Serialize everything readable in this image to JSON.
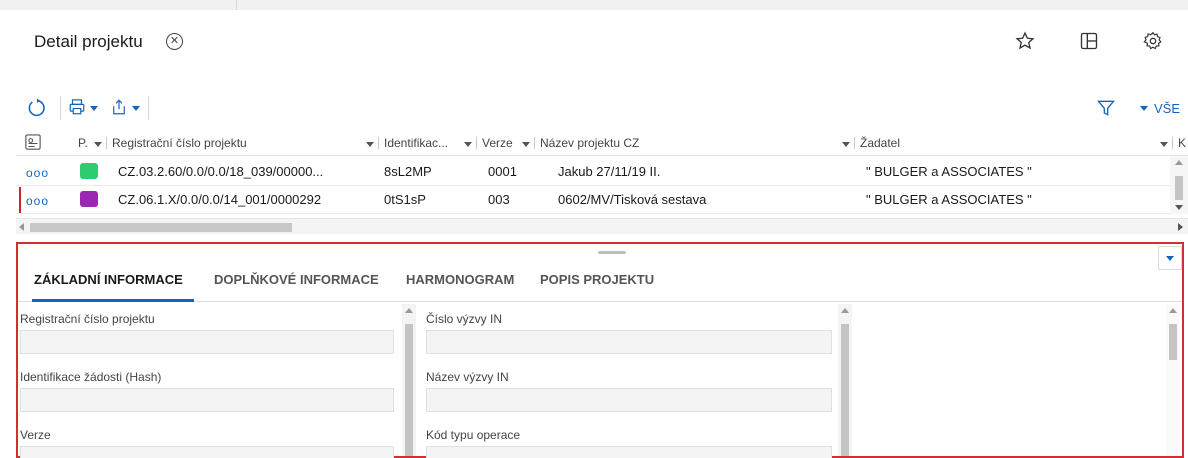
{
  "header": {
    "title": "Detail projektu",
    "close_icon": "close-circle-icon",
    "actions": [
      "star-icon",
      "layout-icon",
      "gear-icon"
    ]
  },
  "toolbar": {
    "refresh_icon": "refresh-icon",
    "print_icon": "print-icon",
    "export_icon": "export-icon",
    "filter_icon": "filter-icon",
    "vse_label": "VŠE"
  },
  "grid": {
    "columns": [
      {
        "key": "p",
        "label": "P."
      },
      {
        "key": "reg",
        "label": "Registrační číslo projektu"
      },
      {
        "key": "ident",
        "label": "Identifikac..."
      },
      {
        "key": "verze",
        "label": "Verze"
      },
      {
        "key": "nazev",
        "label": "Název projektu CZ"
      },
      {
        "key": "zadatel",
        "label": "Žadatel"
      },
      {
        "key": "k",
        "label": "K"
      }
    ],
    "rows": [
      {
        "dots": "ooo",
        "color": "#2ecc71",
        "reg": "CZ.03.2.60/0.0/0.0/18_039/00000...",
        "ident": "8sL2MP",
        "verze": "0001",
        "nazev": "Jakub 27/11/19 II.",
        "zadatel": "\" BULGER a ASSOCIATES \""
      },
      {
        "dots": "ooo",
        "color": "#9c27b0",
        "reg": "CZ.06.1.X/0.0/0.0/14_001/0000292",
        "ident": "0tS1sP",
        "verze": "003",
        "nazev": "0602/MV/Tisková sestava",
        "zadatel": "\" BULGER a ASSOCIATES \""
      }
    ]
  },
  "detail": {
    "tabs": [
      "ZÁKLADNÍ INFORMACE",
      "DOPLŇKOVÉ INFORMACE",
      "HARMONOGRAM",
      "POPIS PROJEKTU"
    ],
    "active_tab": 0,
    "left_fields": [
      "Registrační číslo projektu",
      "Identifikace žádosti (Hash)",
      "Verze"
    ],
    "mid_fields": [
      "Číslo výzvy IN",
      "Název výzvy IN",
      "Kód typu operace"
    ]
  },
  "colors": {
    "accent": "#1565c0",
    "highlight_border": "#d32f2f"
  }
}
